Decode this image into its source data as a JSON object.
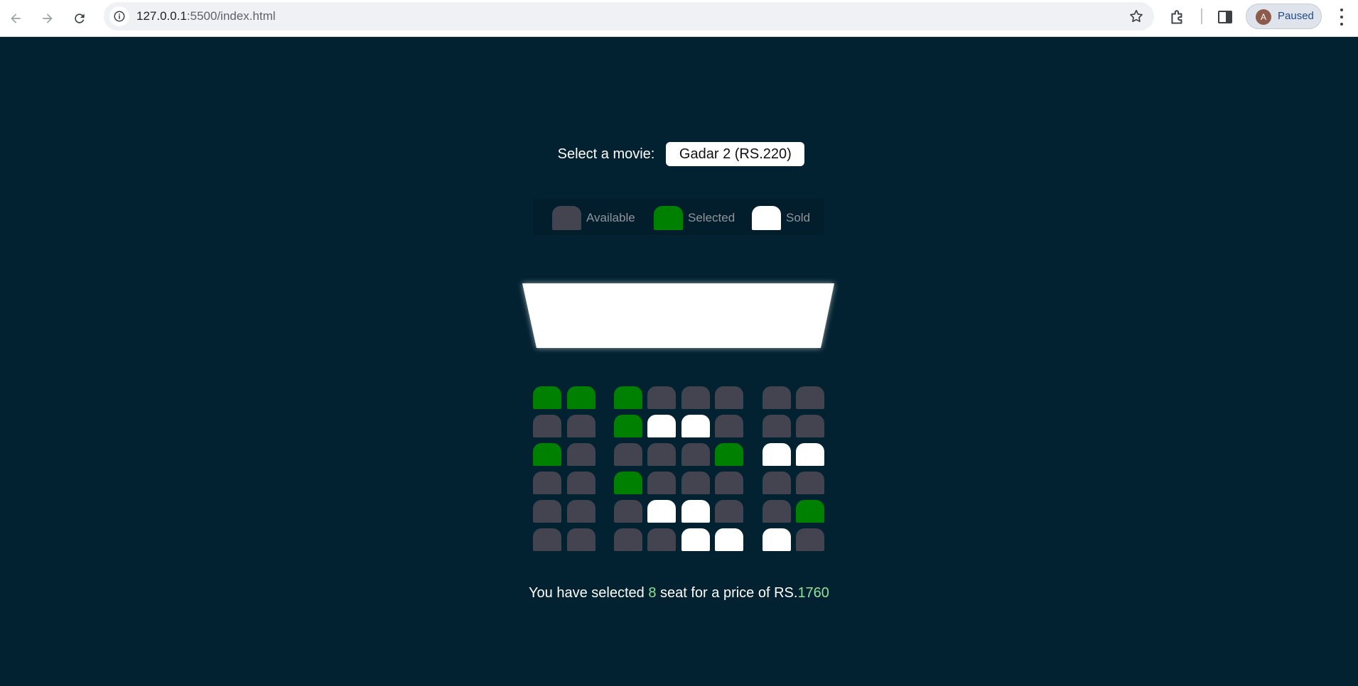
{
  "browser": {
    "url_host": "127.0.0.1",
    "url_path": ":5500/index.html",
    "profile_initial": "A",
    "profile_status": "Paused"
  },
  "colors": {
    "background": "#032231",
    "available": "#444451",
    "selected": "#008000",
    "sold": "#ffffff",
    "highlight": "#8fe29a"
  },
  "movie": {
    "label": "Select a movie:",
    "selected": "Gadar 2 (RS.220)"
  },
  "legend": [
    {
      "status": "available",
      "label": "Available"
    },
    {
      "status": "selected",
      "label": "Selected"
    },
    {
      "status": "sold",
      "label": "Sold"
    }
  ],
  "seats": [
    [
      "selected",
      "selected",
      "selected",
      "available",
      "available",
      "available",
      "available",
      "available"
    ],
    [
      "available",
      "available",
      "selected",
      "sold",
      "sold",
      "available",
      "available",
      "available"
    ],
    [
      "selected",
      "available",
      "available",
      "available",
      "available",
      "selected",
      "sold",
      "sold"
    ],
    [
      "available",
      "available",
      "selected",
      "available",
      "available",
      "available",
      "available",
      "available"
    ],
    [
      "available",
      "available",
      "available",
      "sold",
      "sold",
      "available",
      "available",
      "selected"
    ],
    [
      "available",
      "available",
      "available",
      "available",
      "sold",
      "sold",
      "sold",
      "available"
    ]
  ],
  "summary": {
    "prefix": "You have selected ",
    "count": "8",
    "middle": " seat for a price of RS.",
    "price": "1760"
  }
}
